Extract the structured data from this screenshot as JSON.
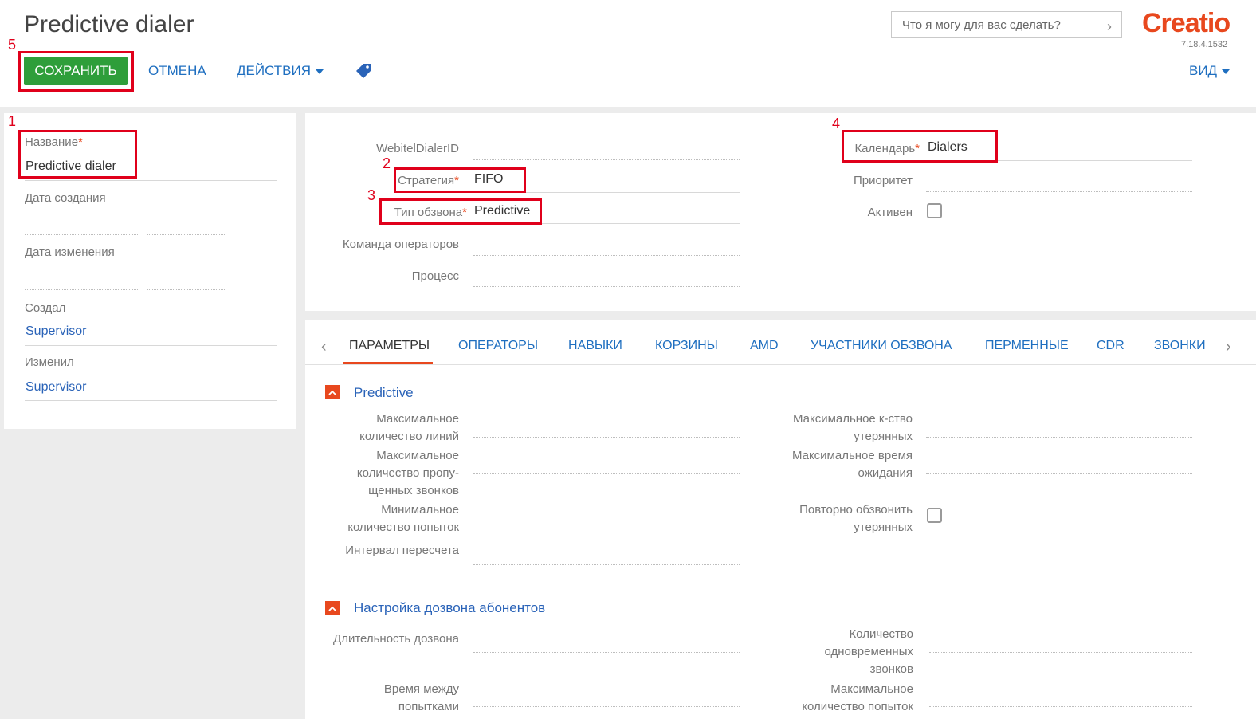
{
  "header": {
    "title": "Predictive dialer",
    "save_label": "СОХРАНИТЬ",
    "cancel_label": "ОТМЕНА",
    "actions_label": "ДЕЙСТВИЯ",
    "view_label": "ВИД",
    "search_placeholder": "Что я могу для вас сделать?",
    "logo_text": "Creatio",
    "version": "7.18.4.1532",
    "tag_icon": "tag-icon"
  },
  "markers": [
    "1",
    "2",
    "3",
    "4",
    "5"
  ],
  "left": {
    "name_label": "Название",
    "name_value": "Predictive dialer",
    "created_label": "Дата создания",
    "modified_label": "Дата изменения",
    "created_by_label": "Создал",
    "created_by_value": "Supervisor",
    "modified_by_label": "Изменил",
    "modified_by_value": "Supervisor"
  },
  "top": {
    "dialer_id_label": "WebitelDialerID",
    "strategy_label": "Стратегия",
    "strategy_value": "FIFO",
    "type_label": "Тип обзвона",
    "type_value": "Predictive",
    "team_label": "Команда операторов",
    "process_label": "Процесс",
    "calendar_label": "Календарь",
    "calendar_value": "Dialers",
    "priority_label": "Приоритет",
    "active_label": "Активен",
    "active_checked": false
  },
  "tabs": [
    "ПАРАМЕТРЫ",
    "ОПЕРАТОРЫ",
    "НАВЫКИ",
    "КОРЗИНЫ",
    "AMD",
    "УЧАСТНИКИ ОБЗВОНА",
    "ПЕРМЕННЫЕ",
    "CDR",
    "ЗВОНКИ"
  ],
  "active_tab": "ПАРАМЕТРЫ",
  "sections": {
    "predictive": {
      "title": "Predictive",
      "max_lines_1": "Максимальное",
      "max_lines_2": "количество линий",
      "max_missed_1": "Максимальное",
      "max_missed_2": "количество пропу-",
      "max_missed_3": "щенных звонков",
      "min_attempts_1": "Минимальное",
      "min_attempts_2": "количество попыток",
      "recalc_interval": "Интервал пересчета",
      "max_lost_1": "Максимальное к-ство",
      "max_lost_2": "утерянных",
      "max_wait_1": "Максимальное время",
      "max_wait_2": "ожидания",
      "redial_lost_1": "Повторно обзвонить",
      "redial_lost_2": "утерянных"
    },
    "dialing": {
      "title": "Настройка дозвона абонентов",
      "duration": "Длительность дозвона",
      "between_1": "Время между",
      "between_2": "попытками",
      "concurrent_1": "Количество",
      "concurrent_2": "одновременных",
      "concurrent_3": "звонков",
      "max_attempts_1": "Максимальное",
      "max_attempts_2": "количество попыток"
    }
  },
  "colors": {
    "accent": "#e8481e",
    "save": "#2e9e3a",
    "link": "#1f6fc0",
    "marker": "#e0001b"
  }
}
